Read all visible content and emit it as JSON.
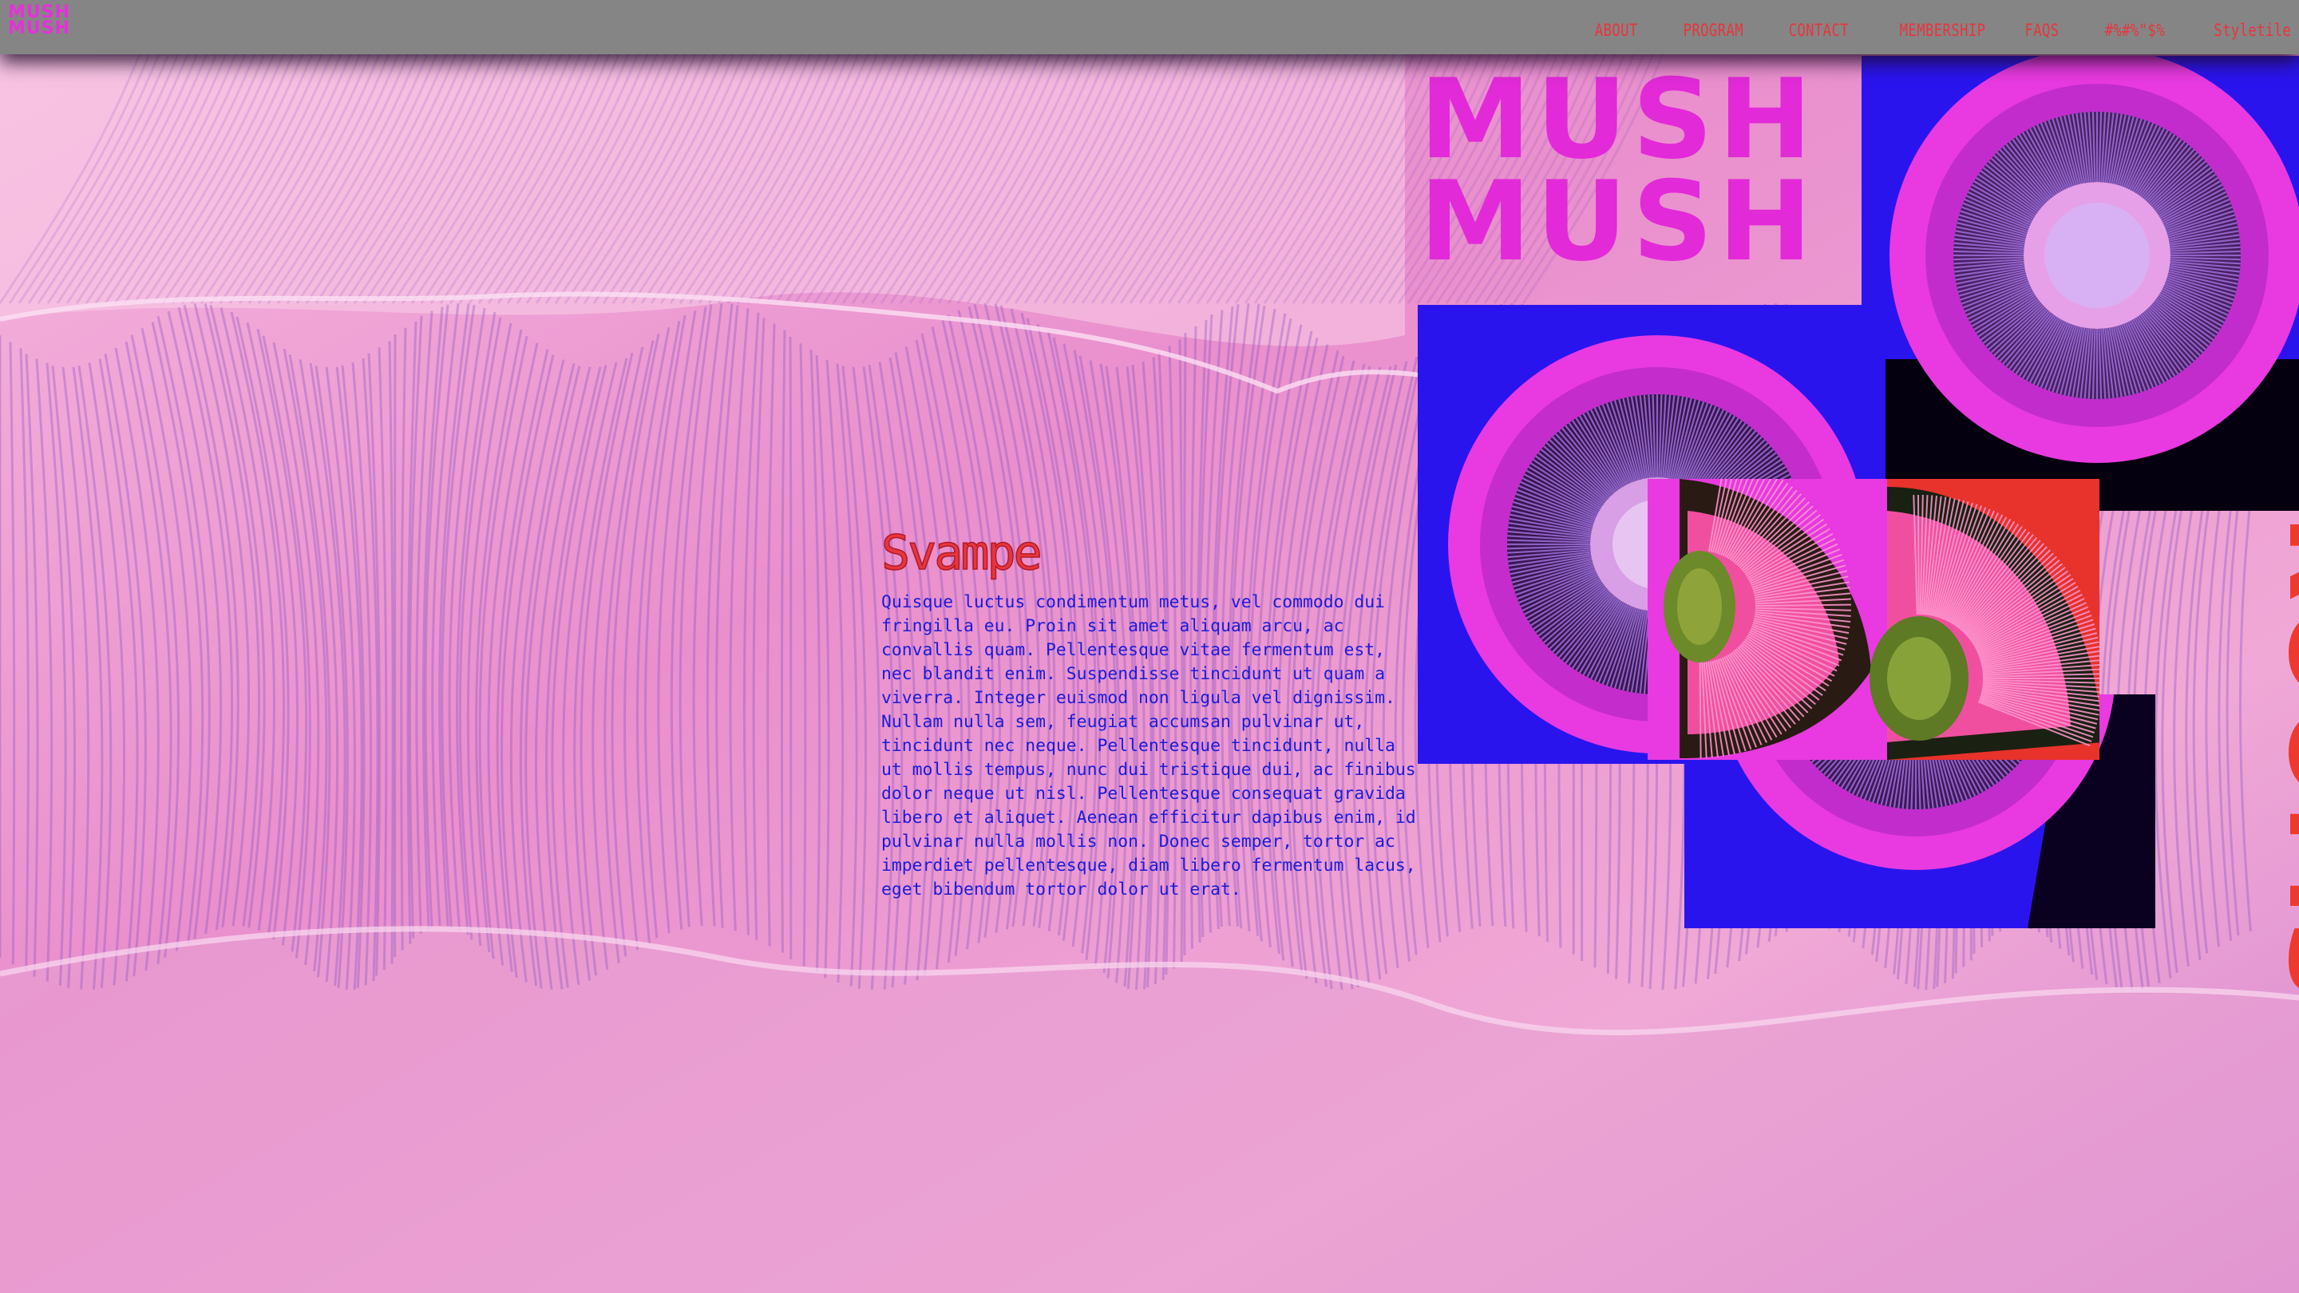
{
  "site": {
    "logo_line1": "MUSH",
    "logo_line2": "MUSH"
  },
  "nav": {
    "items": [
      "ABOUT",
      "PROGRAM",
      "CONTACT",
      "MEMBERSHIP",
      "FAQS",
      "#%#%\"$%",
      "Styletile"
    ]
  },
  "article": {
    "title": "Svampe",
    "body": "Quisque luctus condimentum metus, vel commodo dui fringilla eu. Proin sit amet aliquam arcu, ac convallis quam. Pellentesque vitae fermentum est, nec blandit enim. Suspendisse tincidunt ut quam a viverra. Integer euismod non ligula vel dignissim. Nullam nulla sem, feugiat accumsan pulvinar ut, tincidunt nec neque. Pellentesque tincidunt, nulla ut mollis tempus, nunc dui tristique dui, ac finibus dolor neque ut nisl. Pellentesque consequat gravida libero et aliquet. Aenean efficitur dapibus enim, id pulvinar nulla mollis non. Donec semper, tortor ac imperdiet pellentesque, diam libero fermentum lacus, eget bibendum tortor dolor ut erat."
  },
  "collage": {
    "title_line1": "MUSH",
    "title_line2": "MUSH",
    "vertical_word": "ROOMS"
  },
  "colors": {
    "nav_bg": "#858585",
    "nav_text": "#e8353d",
    "logo": "#e532d8",
    "title_pink": "#e22ad8",
    "rooms_red": "#ee3a2e",
    "body_blue": "#1b1bd8",
    "tile_blue": "#2a14ee",
    "tile_red": "#e8322c",
    "tile_magenta": "#e83ae0"
  }
}
